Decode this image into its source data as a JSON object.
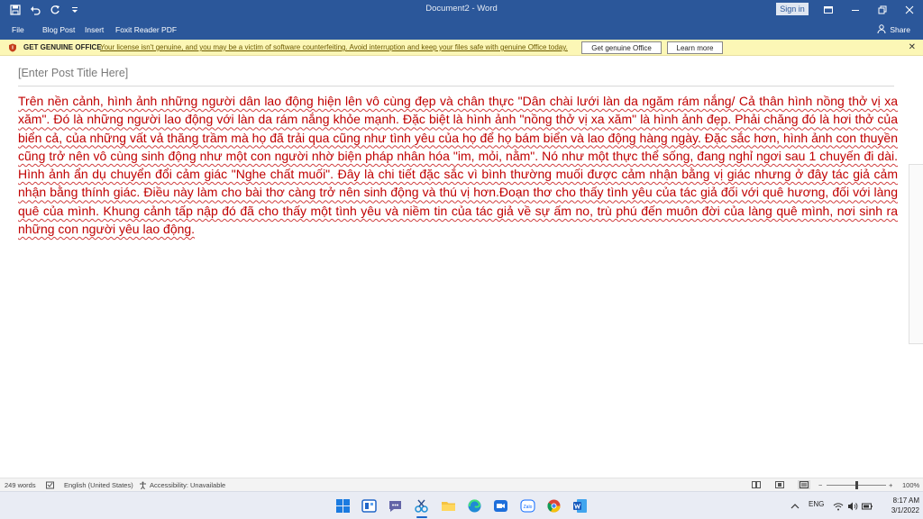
{
  "window": {
    "title": "Document2 - Word",
    "sign_in_label": "Sign in"
  },
  "menu": {
    "items": [
      "File",
      "Blog Post",
      "Insert",
      "Foxit Reader PDF"
    ],
    "share_label": "Share"
  },
  "notice": {
    "title": "GET GENUINE OFFICE",
    "message": "Your license isn't genuine, and you may be a victim of software counterfeiting. Avoid interruption and keep your files safe with genuine Office today.",
    "primary_button": "Get genuine Office",
    "secondary_button": "Learn more"
  },
  "document": {
    "post_title_placeholder": "[Enter Post Title Here]",
    "body": "Trên nền cảnh, hình ảnh những người dân lao động hiện lên vô cùng đẹp và chân thực \"Dân chài lưới làn da ngăm rám nắng/ Cả thân hình nồng thở vị xa xăm\". Đó là những người lao động với làn da rám nắng khỏe mạnh. Đặc biệt là hình ảnh \"nồng thở vị xa xăm\" là hình ảnh đẹp. Phải chăng đó là hơi thở của biển cả, của những vất vả thăng trầm mà họ đã trải qua cũng như tình yêu của họ để họ bám biển và lao động hàng ngày. Đặc sắc hơn, hình ảnh con thuyền cũng trở nên vô cùng sinh động như một con người nhờ biện pháp nhân hóa \"im, mỏi, nằm\". Nó như một thực thể sống, đang nghỉ ngơi sau 1 chuyến đi dài. Hình ảnh ẩn dụ chuyển đổi cảm giác \"Nghe chất muối\". Đây là chi tiết đặc sắc vì bình thường muối được cảm nhận bằng vị giác nhưng ở đây tác giả cảm nhận bằng thính giác. Điều này làm cho bài thơ càng trở nên sinh động và thú vị hơn.Đoạn thơ cho thấy tình yêu của tác giả đối với quê hương, đối với làng quê của mình. Khung cảnh tấp nập đó đã cho thấy một tình yêu và niềm tin của tác giả về sự ấm no, trù phú đến muôn đời của làng quê mình, nơi sinh ra những con người yêu lao động."
  },
  "status": {
    "word_count": "249 words",
    "language": "English (United States)",
    "accessibility": "Accessibility: Unavailable",
    "zoom": "100%"
  },
  "taskbar": {
    "language": "ENG",
    "time": "8:17 AM",
    "date": "3/1/2022",
    "zalo_label": "Zalo"
  },
  "colors": {
    "word_blue": "#2b579a",
    "body_text": "#c00000",
    "notice_bg": "#fcf7b6"
  }
}
